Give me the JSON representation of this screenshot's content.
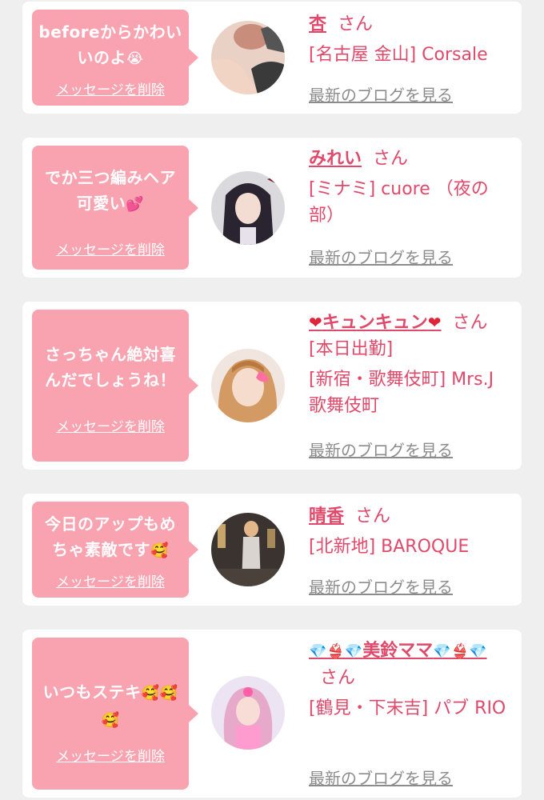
{
  "delete_label": "メッセージを削除",
  "blog_label": "最新のブログを見る",
  "san_label": "さん",
  "cards": [
    {
      "message_text": "beforeからかわいいのよ",
      "message_emoji": "😭",
      "name": "杏",
      "shop": "[名古屋 金山] Corsale"
    },
    {
      "message_text": "でか三つ編みヘア可愛い",
      "message_emoji": "💕",
      "name": "みれい",
      "shop": "[ミナミ] cuore （夜の部）"
    },
    {
      "message_text": "さっちゃん絶対喜んだでしょうね！",
      "name_prefix_icon": "❤",
      "name": "キュンキュン",
      "name_suffix_icon": "❤",
      "shop_prefix": "[本日出勤]",
      "shop": "[新宿・歌舞伎町] Mrs.J 歌舞伎町"
    },
    {
      "message_text": "今日のアップもめちゃ素敵です",
      "message_emoji": "🥰",
      "name": "晴香",
      "shop": "[北新地] BAROQUE"
    },
    {
      "message_text": "いつもステキ",
      "message_emoji": "🥰🥰🥰",
      "name": "美鈴ママ",
      "name_icons_left": "💎👙💎",
      "name_icons_right": "💎👙💎",
      "shop": "[鶴見・下末吉] パブ RIO"
    }
  ]
}
